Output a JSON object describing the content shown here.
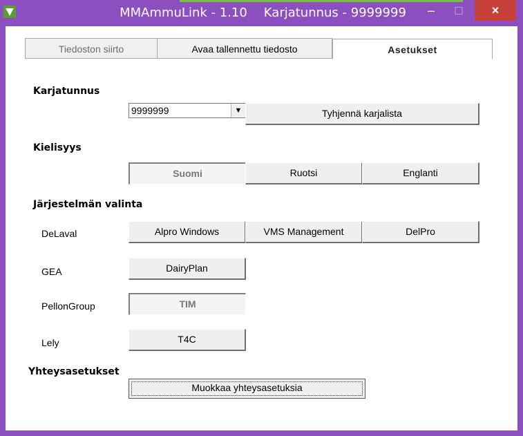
{
  "window": {
    "app_name": "MMAmmuLink - 1.10",
    "subtitle": "Karjatunnus - 9999999",
    "min_symbol": "–",
    "max_symbol": "□",
    "close_symbol": "×",
    "colors": {
      "titlebar": "#8c4fbf",
      "close": "#c8403a",
      "accent": "#7ac142"
    }
  },
  "tabs": [
    {
      "label": "Tiedoston siirto",
      "state": "inactive"
    },
    {
      "label": "Avaa tallennettu tiedosto",
      "state": "inactive"
    },
    {
      "label": "Asetukset",
      "state": "active"
    }
  ],
  "karjatunnus": {
    "heading": "Karjatunnus",
    "select_value": "9999999",
    "clear_button": "Tyhjennä karjalista"
  },
  "language": {
    "heading": "Kielisyys",
    "options": [
      {
        "label": "Suomi",
        "selected": true
      },
      {
        "label": "Ruotsi",
        "selected": false
      },
      {
        "label": "Englanti",
        "selected": false
      }
    ]
  },
  "system": {
    "heading": "Järjestelmän valinta",
    "rows": [
      {
        "vendor": "DeLaval",
        "buttons": [
          "Alpro Windows",
          "VMS Management",
          "DelPro"
        ]
      },
      {
        "vendor": "GEA",
        "buttons": [
          "DairyPlan"
        ]
      },
      {
        "vendor": "PellonGroup",
        "buttons": [
          "TIM"
        ]
      },
      {
        "vendor": "Lely",
        "buttons": [
          "T4C"
        ]
      }
    ]
  },
  "connection": {
    "heading": "Yhteysasetukset",
    "edit_button": "Muokkaa yhteysasetuksia"
  }
}
